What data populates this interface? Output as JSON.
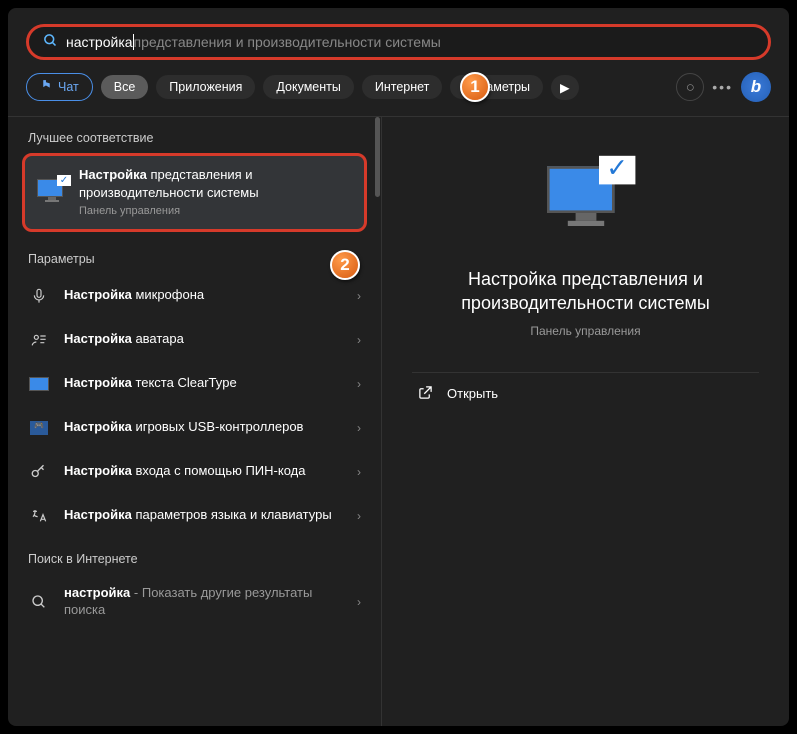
{
  "search": {
    "typed": "настройка",
    "hint": " представления и производительности системы"
  },
  "tabs": {
    "chat": "Чат",
    "all": "Все",
    "apps": "Приложения",
    "docs": "Документы",
    "internet": "Интернет",
    "params": "Параметры"
  },
  "sections": {
    "best": "Лучшее соответствие",
    "params": "Параметры",
    "web": "Поиск в Интернете"
  },
  "best_match": {
    "bold": "Настройка",
    "rest": " представления и производительности системы",
    "sub": "Панель управления"
  },
  "results": [
    {
      "bold": "Настройка",
      "rest": " микрофона"
    },
    {
      "bold": "Настройка",
      "rest": " аватара"
    },
    {
      "bold": "Настройка",
      "rest": " текста ClearType"
    },
    {
      "bold": "Настройка",
      "rest": " игровых USB-контроллеров"
    },
    {
      "bold": "Настройка",
      "rest": " входа с помощью ПИН-кода"
    },
    {
      "bold": "Настройка",
      "rest": " параметров языка и клавиатуры"
    }
  ],
  "web_result": {
    "bold": "настройка",
    "rest": " - Показать другие результаты поиска"
  },
  "detail": {
    "title": "Настройка представления и производительности системы",
    "sub": "Панель управления",
    "open": "Открыть"
  },
  "badges": {
    "b1": "1",
    "b2": "2"
  }
}
